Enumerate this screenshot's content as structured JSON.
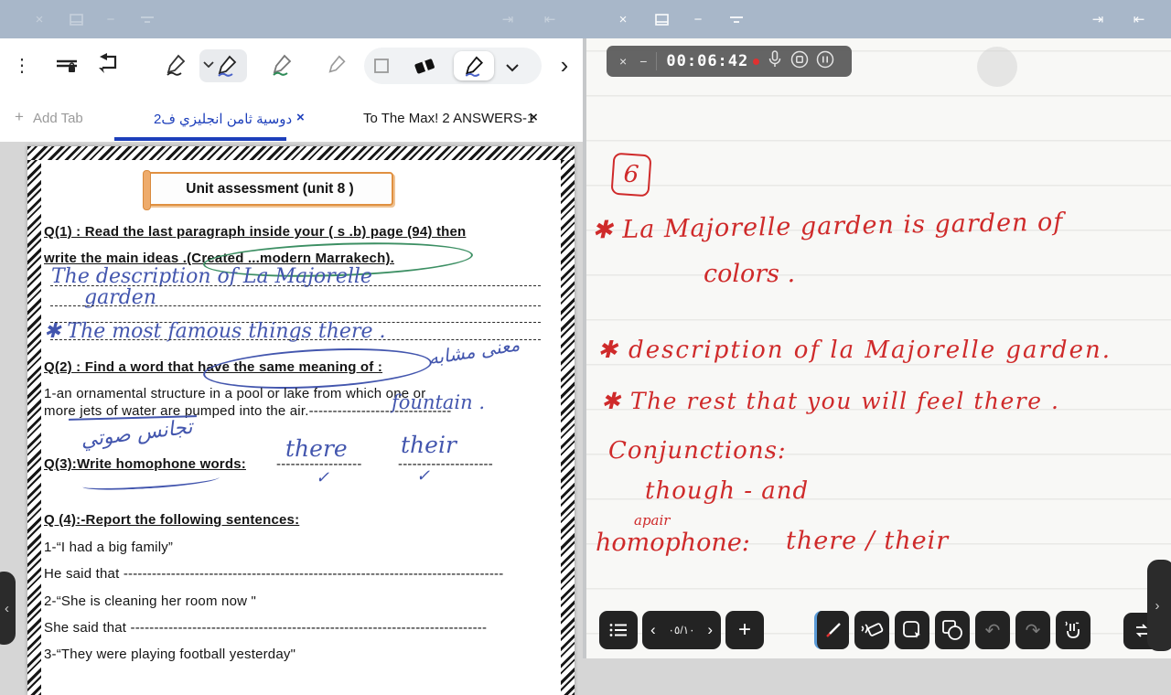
{
  "titlebar": {
    "close": "×",
    "minimize": "−",
    "dock_right": "⇥",
    "dock_left": "⇤"
  },
  "toolbar": {
    "more": "⋮",
    "undo": "↶",
    "expand": "›",
    "chevron": "⌄"
  },
  "tabs": {
    "add_label": "Add Tab",
    "add_plus": "+",
    "tab1_label": "دوسية ثامن انجليزي ف2",
    "tab1_close": "×",
    "tab2_label": "To The Max! 2 ANSWERS-1",
    "tab2_close": "×"
  },
  "doc": {
    "title": "Unit assessment  (unit 8 )",
    "q1_line1": "Q(1) : Read the last  paragraph  inside your ( s .b) page  (94) then",
    "q1_line2": "write the main ideas .(Created  ...modern Marrakech).",
    "ans1_line1": "The description of La Majorelle",
    "ans1_line2": "garden",
    "ans1_line3": "✱ The most famous things there .",
    "q2": "Q(2) : Find a  word that have the same meaning of :",
    "q2_note_arabic": "معنى مشابه",
    "q2_item_line1": "1-an ornamental structure in a pool or lake from which one or",
    "q2_item_line2": "more jets of water are pumped into the air.------------------------------",
    "q2_answer": "fountain .",
    "q3_note_arabic": "تجانس صوتي",
    "q3": "Q(3):Write homophone words:",
    "q3_dash1": "------------------",
    "q3_dash2": "--------------------",
    "q3_answer1": "there",
    "q3_answer2": "their",
    "q3_check1": "✓",
    "q3_check2": "✓",
    "q4": "Q (4):-Report  the following sentences:",
    "s1": "1-“I had a big family”",
    "s1_report": "He said that --------------------------------------------------------------------------------",
    "s2": "2-“She is cleaning  her room now \"",
    "s2_report": "She said that ---------------------------------------------------------------------------",
    "s3": "3-“They were playing football yesterday\""
  },
  "recorder": {
    "close": "×",
    "minimize": "−",
    "time": "00:06:42"
  },
  "notes": {
    "badge": "6",
    "line1": "✱ La Majorelle garden is garden of",
    "line2": "colors .",
    "line3": "✱ description of la Majorelle garden.",
    "line4": "✱ The rest that you will feel there .",
    "line5": "Conjunctions:",
    "line6": "though - and",
    "line7": "apair",
    "line8a": "homophone:",
    "line8b": "there / their"
  },
  "pager": {
    "prev": "‹",
    "next": "›",
    "page_indicator": "٠٥/١٠",
    "add_page": "+"
  },
  "bottom_toolbar": {
    "undo": "↶",
    "redo": "↷"
  },
  "handles": {
    "left": "‹",
    "right": "›"
  },
  "colors": {
    "topbar": "#a8b7c9",
    "blue_ink": "#4356ae",
    "red_ink": "#cf2a2a",
    "green_annotation": "#3c8f63",
    "orange_box": "#e09040",
    "active_tab": "#1d3fbb"
  }
}
